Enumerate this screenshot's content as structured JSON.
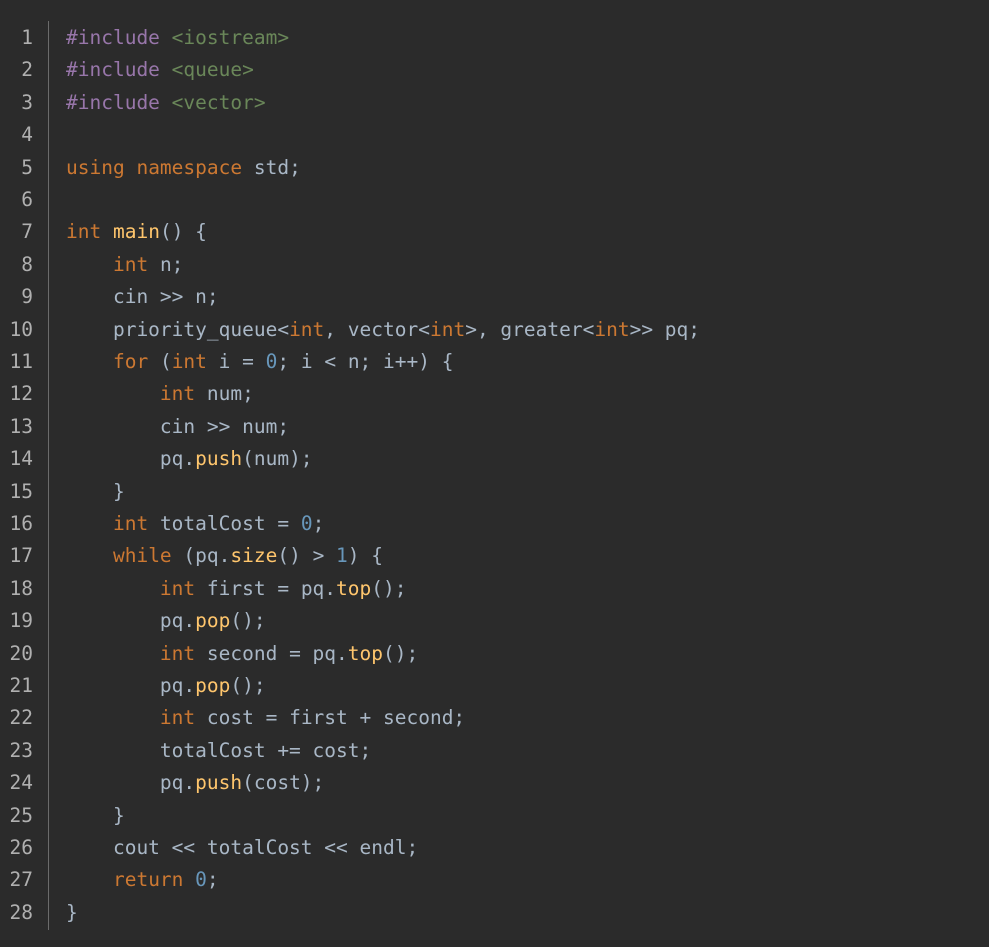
{
  "editor": {
    "language": "cpp",
    "colors": {
      "background": "#2b2b2b",
      "plain": "#a9b7c6",
      "keyword": "#cc7832",
      "preprocessor": "#9876aa",
      "string": "#6a8759",
      "function": "#ffc66d",
      "number": "#6897bb",
      "line_number": "#b0b0b0"
    },
    "lines": [
      {
        "n": "1",
        "tokens": [
          {
            "t": "#include",
            "c": "pp"
          },
          {
            "t": " "
          },
          {
            "t": "<iostream>",
            "c": "str"
          }
        ]
      },
      {
        "n": "2",
        "tokens": [
          {
            "t": "#include",
            "c": "pp"
          },
          {
            "t": " "
          },
          {
            "t": "<queue>",
            "c": "str"
          }
        ]
      },
      {
        "n": "3",
        "tokens": [
          {
            "t": "#include",
            "c": "pp"
          },
          {
            "t": " "
          },
          {
            "t": "<vector>",
            "c": "str"
          }
        ]
      },
      {
        "n": "4",
        "tokens": []
      },
      {
        "n": "5",
        "tokens": [
          {
            "t": "using",
            "c": "kw"
          },
          {
            "t": " "
          },
          {
            "t": "namespace",
            "c": "kw"
          },
          {
            "t": " std;"
          }
        ]
      },
      {
        "n": "6",
        "tokens": []
      },
      {
        "n": "7",
        "tokens": [
          {
            "t": "int",
            "c": "kw"
          },
          {
            "t": " "
          },
          {
            "t": "main",
            "c": "fn"
          },
          {
            "t": "() {"
          }
        ]
      },
      {
        "n": "8",
        "tokens": [
          {
            "t": "    "
          },
          {
            "t": "int",
            "c": "kw"
          },
          {
            "t": " n;"
          }
        ]
      },
      {
        "n": "9",
        "tokens": [
          {
            "t": "    cin >> n;"
          }
        ]
      },
      {
        "n": "10",
        "tokens": [
          {
            "t": "    priority_queue<"
          },
          {
            "t": "int",
            "c": "kw"
          },
          {
            "t": ", vector<"
          },
          {
            "t": "int",
            "c": "kw"
          },
          {
            "t": ">, greater<"
          },
          {
            "t": "int",
            "c": "kw"
          },
          {
            "t": ">> pq;"
          }
        ]
      },
      {
        "n": "11",
        "tokens": [
          {
            "t": "    "
          },
          {
            "t": "for",
            "c": "kw"
          },
          {
            "t": " ("
          },
          {
            "t": "int",
            "c": "kw"
          },
          {
            "t": " i = "
          },
          {
            "t": "0",
            "c": "num"
          },
          {
            "t": "; i < n; i++) {"
          }
        ]
      },
      {
        "n": "12",
        "tokens": [
          {
            "t": "        "
          },
          {
            "t": "int",
            "c": "kw"
          },
          {
            "t": " num;"
          }
        ]
      },
      {
        "n": "13",
        "tokens": [
          {
            "t": "        cin >> num;"
          }
        ]
      },
      {
        "n": "14",
        "tokens": [
          {
            "t": "        pq."
          },
          {
            "t": "push",
            "c": "fn"
          },
          {
            "t": "(num);"
          }
        ]
      },
      {
        "n": "15",
        "tokens": [
          {
            "t": "    }"
          }
        ]
      },
      {
        "n": "16",
        "tokens": [
          {
            "t": "    "
          },
          {
            "t": "int",
            "c": "kw"
          },
          {
            "t": " totalCost = "
          },
          {
            "t": "0",
            "c": "num"
          },
          {
            "t": ";"
          }
        ]
      },
      {
        "n": "17",
        "tokens": [
          {
            "t": "    "
          },
          {
            "t": "while",
            "c": "kw"
          },
          {
            "t": " (pq."
          },
          {
            "t": "size",
            "c": "fn"
          },
          {
            "t": "() > "
          },
          {
            "t": "1",
            "c": "num"
          },
          {
            "t": ") {"
          }
        ]
      },
      {
        "n": "18",
        "tokens": [
          {
            "t": "        "
          },
          {
            "t": "int",
            "c": "kw"
          },
          {
            "t": " first = pq."
          },
          {
            "t": "top",
            "c": "fn"
          },
          {
            "t": "();"
          }
        ]
      },
      {
        "n": "19",
        "tokens": [
          {
            "t": "        pq."
          },
          {
            "t": "pop",
            "c": "fn"
          },
          {
            "t": "();"
          }
        ]
      },
      {
        "n": "20",
        "tokens": [
          {
            "t": "        "
          },
          {
            "t": "int",
            "c": "kw"
          },
          {
            "t": " second = pq."
          },
          {
            "t": "top",
            "c": "fn"
          },
          {
            "t": "();"
          }
        ]
      },
      {
        "n": "21",
        "tokens": [
          {
            "t": "        pq."
          },
          {
            "t": "pop",
            "c": "fn"
          },
          {
            "t": "();"
          }
        ]
      },
      {
        "n": "22",
        "tokens": [
          {
            "t": "        "
          },
          {
            "t": "int",
            "c": "kw"
          },
          {
            "t": " cost = first + second;"
          }
        ]
      },
      {
        "n": "23",
        "tokens": [
          {
            "t": "        totalCost += cost;"
          }
        ]
      },
      {
        "n": "24",
        "tokens": [
          {
            "t": "        pq."
          },
          {
            "t": "push",
            "c": "fn"
          },
          {
            "t": "(cost);"
          }
        ]
      },
      {
        "n": "25",
        "tokens": [
          {
            "t": "    }"
          }
        ]
      },
      {
        "n": "26",
        "tokens": [
          {
            "t": "    cout << totalCost << endl;"
          }
        ]
      },
      {
        "n": "27",
        "tokens": [
          {
            "t": "    "
          },
          {
            "t": "return",
            "c": "kw"
          },
          {
            "t": " "
          },
          {
            "t": "0",
            "c": "num"
          },
          {
            "t": ";"
          }
        ]
      },
      {
        "n": "28",
        "tokens": [
          {
            "t": "}"
          }
        ]
      }
    ]
  }
}
